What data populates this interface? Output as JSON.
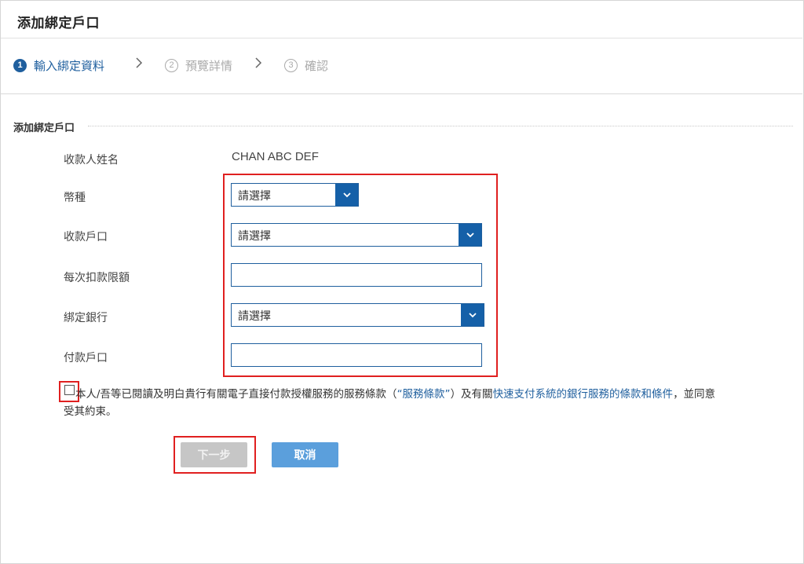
{
  "page": {
    "title": "添加綁定戶口"
  },
  "steps": [
    {
      "number": "1",
      "label": "輸入綁定資料",
      "active": true
    },
    {
      "number": "2",
      "label": "預覽詳情",
      "active": false
    },
    {
      "number": "3",
      "label": "確認",
      "active": false
    }
  ],
  "section": {
    "title": "添加綁定戶口"
  },
  "form": {
    "payee_name": {
      "label": "收款人姓名",
      "value": "CHAN ABC DEF"
    },
    "currency": {
      "label": "幣種",
      "value": "請選擇"
    },
    "receiving_account": {
      "label": "收款戶口",
      "value": "請選擇"
    },
    "debit_limit": {
      "label": "每次扣款限額",
      "value": ""
    },
    "bank": {
      "label": "綁定銀行",
      "value": "請選擇"
    },
    "paying_account": {
      "label": "付款戶口",
      "value": ""
    }
  },
  "terms": {
    "part1": "本人/吾等已閱讀及明白貴行有關電子直接付款授權服務的服務條款（",
    "link1": "“服務條款”",
    "part2": "）及有關",
    "link2": "快速支付系統的銀行服務的條款和條件",
    "part3": "，並同意",
    "line2": "受其約束。"
  },
  "buttons": {
    "next": "下一步",
    "cancel": "取消"
  },
  "colors": {
    "primary": "#1f5f9e",
    "dropdown": "#1560a8",
    "highlight": "#e02020",
    "disabled": "#c6c6c6",
    "cancel": "#5b9fdc"
  }
}
